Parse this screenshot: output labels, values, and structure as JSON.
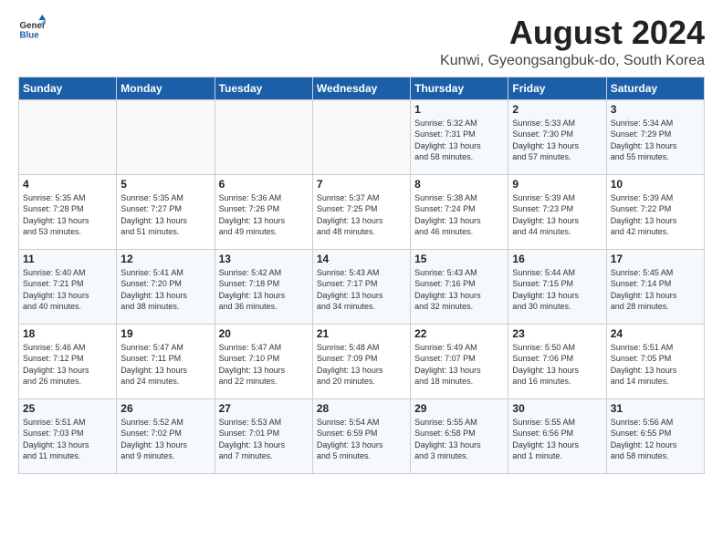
{
  "logo": {
    "line1": "General",
    "line2": "Blue"
  },
  "title": "August 2024",
  "subtitle": "Kunwi, Gyeongsangbuk-do, South Korea",
  "weekdays": [
    "Sunday",
    "Monday",
    "Tuesday",
    "Wednesday",
    "Thursday",
    "Friday",
    "Saturday"
  ],
  "weeks": [
    [
      {
        "day": "",
        "info": ""
      },
      {
        "day": "",
        "info": ""
      },
      {
        "day": "",
        "info": ""
      },
      {
        "day": "",
        "info": ""
      },
      {
        "day": "1",
        "info": "Sunrise: 5:32 AM\nSunset: 7:31 PM\nDaylight: 13 hours\nand 58 minutes."
      },
      {
        "day": "2",
        "info": "Sunrise: 5:33 AM\nSunset: 7:30 PM\nDaylight: 13 hours\nand 57 minutes."
      },
      {
        "day": "3",
        "info": "Sunrise: 5:34 AM\nSunset: 7:29 PM\nDaylight: 13 hours\nand 55 minutes."
      }
    ],
    [
      {
        "day": "4",
        "info": "Sunrise: 5:35 AM\nSunset: 7:28 PM\nDaylight: 13 hours\nand 53 minutes."
      },
      {
        "day": "5",
        "info": "Sunrise: 5:35 AM\nSunset: 7:27 PM\nDaylight: 13 hours\nand 51 minutes."
      },
      {
        "day": "6",
        "info": "Sunrise: 5:36 AM\nSunset: 7:26 PM\nDaylight: 13 hours\nand 49 minutes."
      },
      {
        "day": "7",
        "info": "Sunrise: 5:37 AM\nSunset: 7:25 PM\nDaylight: 13 hours\nand 48 minutes."
      },
      {
        "day": "8",
        "info": "Sunrise: 5:38 AM\nSunset: 7:24 PM\nDaylight: 13 hours\nand 46 minutes."
      },
      {
        "day": "9",
        "info": "Sunrise: 5:39 AM\nSunset: 7:23 PM\nDaylight: 13 hours\nand 44 minutes."
      },
      {
        "day": "10",
        "info": "Sunrise: 5:39 AM\nSunset: 7:22 PM\nDaylight: 13 hours\nand 42 minutes."
      }
    ],
    [
      {
        "day": "11",
        "info": "Sunrise: 5:40 AM\nSunset: 7:21 PM\nDaylight: 13 hours\nand 40 minutes."
      },
      {
        "day": "12",
        "info": "Sunrise: 5:41 AM\nSunset: 7:20 PM\nDaylight: 13 hours\nand 38 minutes."
      },
      {
        "day": "13",
        "info": "Sunrise: 5:42 AM\nSunset: 7:18 PM\nDaylight: 13 hours\nand 36 minutes."
      },
      {
        "day": "14",
        "info": "Sunrise: 5:43 AM\nSunset: 7:17 PM\nDaylight: 13 hours\nand 34 minutes."
      },
      {
        "day": "15",
        "info": "Sunrise: 5:43 AM\nSunset: 7:16 PM\nDaylight: 13 hours\nand 32 minutes."
      },
      {
        "day": "16",
        "info": "Sunrise: 5:44 AM\nSunset: 7:15 PM\nDaylight: 13 hours\nand 30 minutes."
      },
      {
        "day": "17",
        "info": "Sunrise: 5:45 AM\nSunset: 7:14 PM\nDaylight: 13 hours\nand 28 minutes."
      }
    ],
    [
      {
        "day": "18",
        "info": "Sunrise: 5:46 AM\nSunset: 7:12 PM\nDaylight: 13 hours\nand 26 minutes."
      },
      {
        "day": "19",
        "info": "Sunrise: 5:47 AM\nSunset: 7:11 PM\nDaylight: 13 hours\nand 24 minutes."
      },
      {
        "day": "20",
        "info": "Sunrise: 5:47 AM\nSunset: 7:10 PM\nDaylight: 13 hours\nand 22 minutes."
      },
      {
        "day": "21",
        "info": "Sunrise: 5:48 AM\nSunset: 7:09 PM\nDaylight: 13 hours\nand 20 minutes."
      },
      {
        "day": "22",
        "info": "Sunrise: 5:49 AM\nSunset: 7:07 PM\nDaylight: 13 hours\nand 18 minutes."
      },
      {
        "day": "23",
        "info": "Sunrise: 5:50 AM\nSunset: 7:06 PM\nDaylight: 13 hours\nand 16 minutes."
      },
      {
        "day": "24",
        "info": "Sunrise: 5:51 AM\nSunset: 7:05 PM\nDaylight: 13 hours\nand 14 minutes."
      }
    ],
    [
      {
        "day": "25",
        "info": "Sunrise: 5:51 AM\nSunset: 7:03 PM\nDaylight: 13 hours\nand 11 minutes."
      },
      {
        "day": "26",
        "info": "Sunrise: 5:52 AM\nSunset: 7:02 PM\nDaylight: 13 hours\nand 9 minutes."
      },
      {
        "day": "27",
        "info": "Sunrise: 5:53 AM\nSunset: 7:01 PM\nDaylight: 13 hours\nand 7 minutes."
      },
      {
        "day": "28",
        "info": "Sunrise: 5:54 AM\nSunset: 6:59 PM\nDaylight: 13 hours\nand 5 minutes."
      },
      {
        "day": "29",
        "info": "Sunrise: 5:55 AM\nSunset: 6:58 PM\nDaylight: 13 hours\nand 3 minutes."
      },
      {
        "day": "30",
        "info": "Sunrise: 5:55 AM\nSunset: 6:56 PM\nDaylight: 13 hours\nand 1 minute."
      },
      {
        "day": "31",
        "info": "Sunrise: 5:56 AM\nSunset: 6:55 PM\nDaylight: 12 hours\nand 58 minutes."
      }
    ]
  ]
}
